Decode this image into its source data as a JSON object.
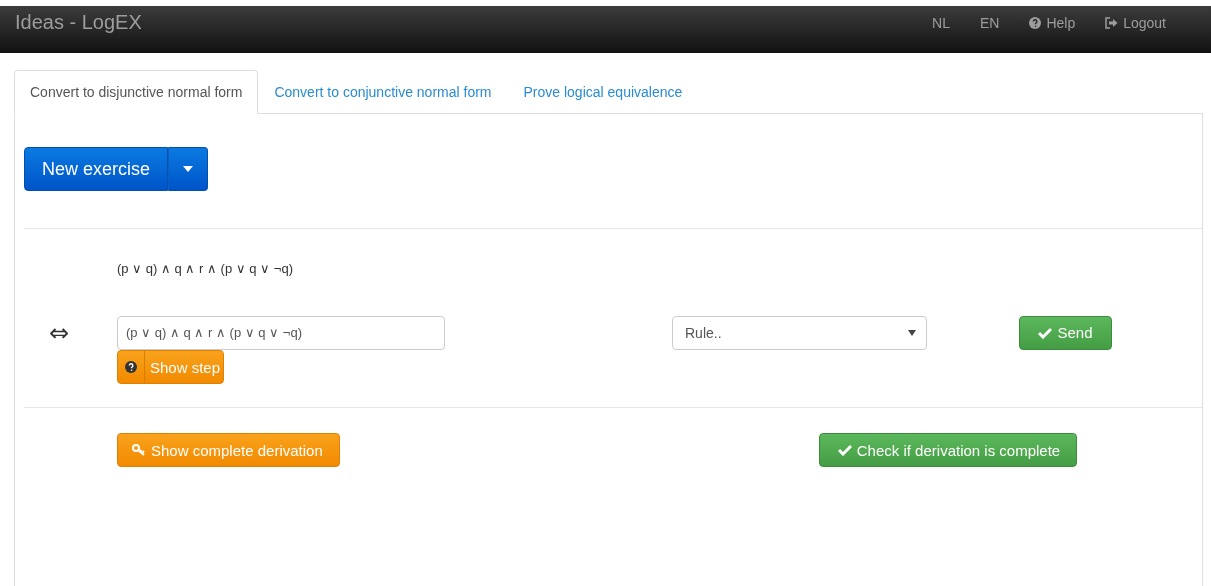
{
  "navbar": {
    "brand": "Ideas - LogEX",
    "links": [
      {
        "label": "NL",
        "kind": "plain"
      },
      {
        "label": "EN",
        "kind": "plain"
      },
      {
        "label": "Help",
        "kind": "help"
      },
      {
        "label": "Logout",
        "kind": "logout"
      }
    ]
  },
  "tabs": [
    {
      "label": "Convert to disjunctive normal form",
      "selected": true
    },
    {
      "label": "Convert to conjunctive normal form",
      "selected": false
    },
    {
      "label": "Prove logical equivalence",
      "selected": false
    }
  ],
  "new_exercise_button": "New exercise",
  "start_formula": "(p ∨ q) ∧ q ∧ r ∧ (p ∨ q ∨ ¬q)",
  "step": {
    "symbol": "⇔",
    "value": "(p ∨ q) ∧ q ∧ r ∧ (p ∨ q ∨ ¬q)",
    "rule_placeholder": "Rule..",
    "send_button": "Send",
    "show_step_button": "Show step"
  },
  "show_derivation_button": "Show complete derivation",
  "check_button": "Check if derivation is complete"
}
